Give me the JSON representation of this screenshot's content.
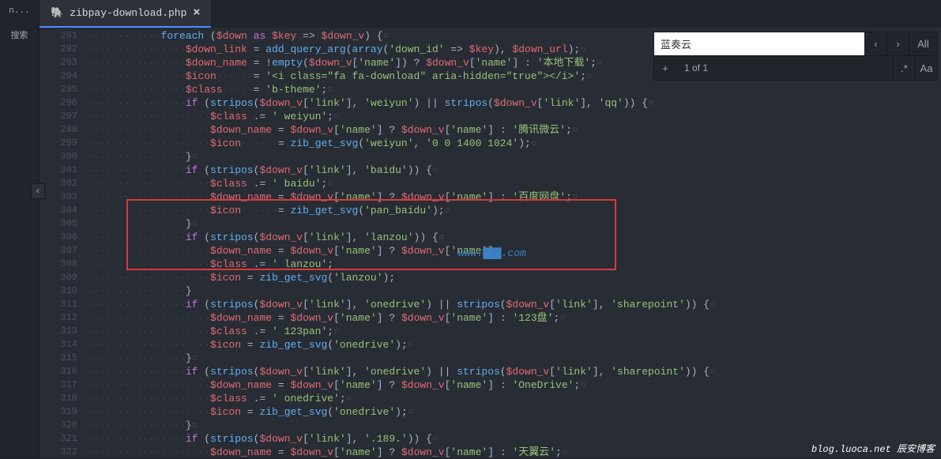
{
  "sidebar": {
    "items": [
      "n...",
      "搜索"
    ]
  },
  "tab": {
    "icon": "🐘",
    "label": "zibpay-download.php",
    "close": "×"
  },
  "lines": [
    {
      "n": 291,
      "html": "<span class='indent'>············</span><span class='fn'>foreach</span> <span class='punc'>(</span><span class='var'>$down</span> <span class='kw'>as</span> <span class='var'>$key</span> <span class='op'>=&gt;</span> <span class='var'>$down_v</span><span class='punc'>) {</span><span class='ws'>¤</span>"
    },
    {
      "n": 292,
      "html": "<span class='indent'>················</span><span class='var'>$down_link</span> <span class='op'>=</span> <span class='fn'>add_query_arg</span><span class='punc'>(</span><span class='fn'>array</span><span class='punc'>(</span><span class='str'>'down_id'</span> <span class='op'>=&gt;</span> <span class='var'>$key</span><span class='punc'>), </span><span class='var'>$down_url</span><span class='punc'>);</span><span class='ws'>¤</span>"
    },
    {
      "n": 293,
      "html": "<span class='indent'>················</span><span class='var'>$down_name</span> <span class='op'>=</span> <span class='op'>!</span><span class='fn'>empty</span><span class='punc'>(</span><span class='var'>$down_v</span><span class='punc'>[</span><span class='str'>'name'</span><span class='punc'>])</span> <span class='op'>?</span> <span class='var'>$down_v</span><span class='punc'>[</span><span class='str'>'name'</span><span class='punc'>]</span> <span class='op'>:</span> <span class='str'>'本地下载'</span><span class='punc'>;</span><span class='ws'>¤</span>"
    },
    {
      "n": 294,
      "html": "<span class='indent'>················</span><span class='var'>$icon</span><span class='indent'>······</span><span class='op'>=</span> <span class='str'>'&lt;i class=\"fa fa-download\" aria-hidden=\"true\"&gt;&lt;/i&gt;'</span><span class='punc'>;</span><span class='ws'>¤</span>"
    },
    {
      "n": 295,
      "html": "<span class='indent'>················</span><span class='var'>$class</span><span class='indent'>·····</span><span class='op'>=</span> <span class='str'>'b-theme'</span><span class='punc'>;</span><span class='ws'>¤</span>"
    },
    {
      "n": 296,
      "html": "<span class='indent'>················</span><span class='kw'>if</span> <span class='punc'>(</span><span class='fn'>stripos</span><span class='punc'>(</span><span class='var'>$down_v</span><span class='punc'>[</span><span class='str'>'link'</span><span class='punc'>], </span><span class='str'>'weiyun'</span><span class='punc'>)</span> <span class='op'>||</span> <span class='fn'>stripos</span><span class='punc'>(</span><span class='var'>$down_v</span><span class='punc'>[</span><span class='str'>'link'</span><span class='punc'>], </span><span class='str'>'qq'</span><span class='punc'>)) {</span><span class='ws'>¤</span>"
    },
    {
      "n": 297,
      "html": "<span class='indent'>····················</span><span class='var'>$class</span> <span class='op'>.=</span> <span class='str'>' weiyun'</span><span class='punc'>;</span><span class='ws'>¤</span>"
    },
    {
      "n": 298,
      "html": "<span class='indent'>····················</span><span class='var'>$down_name</span> <span class='op'>=</span> <span class='var'>$down_v</span><span class='punc'>[</span><span class='str'>'name'</span><span class='punc'>]</span> <span class='op'>?</span> <span class='var'>$down_v</span><span class='punc'>[</span><span class='str'>'name'</span><span class='punc'>]</span> <span class='op'>:</span> <span class='str'>'腾讯微云'</span><span class='punc'>;</span><span class='ws'>¤</span>"
    },
    {
      "n": 299,
      "html": "<span class='indent'>····················</span><span class='var'>$icon</span><span class='indent'>······</span><span class='op'>=</span> <span class='fn'>zib_get_svg</span><span class='punc'>(</span><span class='str'>'weiyun'</span><span class='punc'>, </span><span class='str'>'0 0 1400 1024'</span><span class='punc'>);</span><span class='ws'>¤</span>"
    },
    {
      "n": 300,
      "html": "<span class='indent'>················</span><span class='punc'>}</span><span class='ws'>¤</span>"
    },
    {
      "n": 301,
      "html": "<span class='indent'>················</span><span class='kw'>if</span> <span class='punc'>(</span><span class='fn'>stripos</span><span class='punc'>(</span><span class='var'>$down_v</span><span class='punc'>[</span><span class='str'>'link'</span><span class='punc'>], </span><span class='str'>'baidu'</span><span class='punc'>)) {</span><span class='ws'>¤</span>"
    },
    {
      "n": 302,
      "html": "<span class='indent'>····················</span><span class='var'>$class</span> <span class='op'>.=</span> <span class='str'>' baidu'</span><span class='punc'>;</span><span class='ws'>¤</span>"
    },
    {
      "n": 303,
      "html": "<span class='indent'>····················</span><span class='var'>$down_name</span> <span class='op'>=</span> <span class='var'>$down_v</span><span class='punc'>[</span><span class='str'>'name'</span><span class='punc'>]</span> <span class='op'>?</span> <span class='var'>$down_v</span><span class='punc'>[</span><span class='str'>'name'</span><span class='punc'>]</span> <span class='op'>:</span> <span class='str'>'百度网盘'</span><span class='punc'>;</span><span class='ws'>¤</span>"
    },
    {
      "n": 304,
      "html": "<span class='indent'>····················</span><span class='var'>$icon</span><span class='indent'>······</span><span class='op'>=</span> <span class='fn'>zib_get_svg</span><span class='punc'>(</span><span class='str'>'pan_baidu'</span><span class='punc'>);</span><span class='ws'>¤</span>"
    },
    {
      "n": 305,
      "html": "<span class='indent'>················</span><span class='punc'>}</span><span class='ws'>¤</span>"
    },
    {
      "n": 306,
      "html": "<span class='indent'>················</span><span class='kw'>if</span> <span class='punc'>(</span><span class='fn'>stripos</span><span class='punc'>(</span><span class='var'>$down_v</span><span class='punc'>[</span><span class='str'>'link'</span><span class='punc'>], </span><span class='str'>'lanzou'</span><span class='punc'>)) {</span><span class='ws'>¤</span>"
    },
    {
      "n": 307,
      "html": "<span class='indent'>····················</span><span class='var'>$down_name</span> <span class='op'>=</span> <span class='var'>$down_v</span><span class='punc'>[</span><span class='str'>'name'</span><span class='punc'>]</span> <span class='op'>?</span> <span class='var'>$down_v</span><span class='punc'>[</span><span class='str'>'name'</span><span class='punc'>]</span>"
    },
    {
      "n": 308,
      "html": "<span class='indent'>····················</span><span class='var'>$class</span> <span class='op'>.=</span> <span class='str'>' lanzou'</span><span class='punc'>;</span>"
    },
    {
      "n": 309,
      "html": "<span class='indent'>····················</span><span class='var'>$icon</span> <span class='op'>=</span> <span class='fn'>zib_get_svg</span><span class='punc'>(</span><span class='str'>'lanzou'</span><span class='punc'>);</span>"
    },
    {
      "n": 310,
      "html": "<span class='indent'>················</span><span class='punc'>}</span>"
    },
    {
      "n": 311,
      "html": "<span class='indent'>················</span><span class='kw'>if</span> <span class='punc'>(</span><span class='fn'>stripos</span><span class='punc'>(</span><span class='var'>$down_v</span><span class='punc'>[</span><span class='str'>'link'</span><span class='punc'>], </span><span class='str'>'onedrive'</span><span class='punc'>)</span> <span class='op'>||</span> <span class='fn'>stripos</span><span class='punc'>(</span><span class='var'>$down_v</span><span class='punc'>[</span><span class='str'>'link'</span><span class='punc'>], </span><span class='str'>'sharepoint'</span><span class='punc'>)) {</span><span class='ws'>¤</span>"
    },
    {
      "n": 312,
      "html": "<span class='indent'>····················</span><span class='var'>$down_name</span> <span class='op'>=</span> <span class='var'>$down_v</span><span class='punc'>[</span><span class='str'>'name'</span><span class='punc'>]</span> <span class='op'>?</span> <span class='var'>$down_v</span><span class='punc'>[</span><span class='str'>'name'</span><span class='punc'>]</span> <span class='op'>:</span> <span class='str'>'123盘'</span><span class='punc'>;</span><span class='ws'>¤</span>"
    },
    {
      "n": 313,
      "html": "<span class='indent'>····················</span><span class='var'>$class</span> <span class='op'>.=</span> <span class='str'>' 123pan'</span><span class='punc'>;</span><span class='ws'>¤</span>"
    },
    {
      "n": 314,
      "html": "<span class='indent'>····················</span><span class='var'>$icon</span> <span class='op'>=</span> <span class='fn'>zib_get_svg</span><span class='punc'>(</span><span class='str'>'onedrive'</span><span class='punc'>);</span><span class='ws'>¤</span>"
    },
    {
      "n": 315,
      "html": "<span class='indent'>················</span><span class='punc'>}</span><span class='ws'>¤</span>"
    },
    {
      "n": 316,
      "html": "<span class='indent'>················</span><span class='kw'>if</span> <span class='punc'>(</span><span class='fn'>stripos</span><span class='punc'>(</span><span class='var'>$down_v</span><span class='punc'>[</span><span class='str'>'link'</span><span class='punc'>], </span><span class='str'>'onedrive'</span><span class='punc'>)</span> <span class='op'>||</span> <span class='fn'>stripos</span><span class='punc'>(</span><span class='var'>$down_v</span><span class='punc'>[</span><span class='str'>'link'</span><span class='punc'>], </span><span class='str'>'sharepoint'</span><span class='punc'>)) {</span><span class='ws'>¤</span>"
    },
    {
      "n": 317,
      "html": "<span class='indent'>····················</span><span class='var'>$down_name</span> <span class='op'>=</span> <span class='var'>$down_v</span><span class='punc'>[</span><span class='str'>'name'</span><span class='punc'>]</span> <span class='op'>?</span> <span class='var'>$down_v</span><span class='punc'>[</span><span class='str'>'name'</span><span class='punc'>]</span> <span class='op'>:</span> <span class='str'>'OneDrive'</span><span class='punc'>;</span><span class='ws'>¤</span>"
    },
    {
      "n": 318,
      "html": "<span class='indent'>····················</span><span class='var'>$class</span> <span class='op'>.=</span> <span class='str'>' onedrive'</span><span class='punc'>;</span><span class='ws'>¤</span>"
    },
    {
      "n": 319,
      "html": "<span class='indent'>····················</span><span class='var'>$icon</span> <span class='op'>=</span> <span class='fn'>zib_get_svg</span><span class='punc'>(</span><span class='str'>'onedrive'</span><span class='punc'>);</span><span class='ws'>¤</span>"
    },
    {
      "n": 320,
      "html": "<span class='indent'>················</span><span class='punc'>}</span><span class='ws'>¤</span>"
    },
    {
      "n": 321,
      "html": "<span class='indent'>················</span><span class='kw'>if</span> <span class='punc'>(</span><span class='fn'>stripos</span><span class='punc'>(</span><span class='var'>$down_v</span><span class='punc'>[</span><span class='str'>'link'</span><span class='punc'>], </span><span class='str'>'.189.'</span><span class='punc'>)) {</span><span class='ws'>¤</span>"
    },
    {
      "n": 322,
      "html": "<span class='indent'>····················</span><span class='var'>$down_name</span> <span class='op'>=</span> <span class='var'>$down_v</span><span class='punc'>[</span><span class='str'>'name'</span><span class='punc'>]</span> <span class='op'>?</span> <span class='var'>$down_v</span><span class='punc'>[</span><span class='str'>'name'</span><span class='punc'>]</span> <span class='op'>:</span> <span class='str'>'天翼云'</span><span class='punc'>;</span><span class='ws'>¤</span>"
    }
  ],
  "find": {
    "query": "蓝奏云",
    "count": "1 of 1",
    "prev": "‹",
    "next": "›",
    "addline": "+",
    "regex": ".*",
    "case": "Aa",
    "all": "All"
  },
  "handle": "‹",
  "watermark_inline": "www.███.com",
  "watermark_footer": "blog.luoca.net 辰安博客"
}
